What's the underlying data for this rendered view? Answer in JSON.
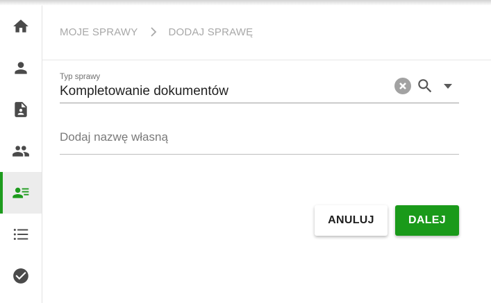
{
  "sidebar": {
    "items": [
      {
        "icon": "home-icon",
        "active": false
      },
      {
        "icon": "person-icon",
        "active": false
      },
      {
        "icon": "document-person-icon",
        "active": false
      },
      {
        "icon": "people-icon",
        "active": false
      },
      {
        "icon": "contact-list-icon",
        "active": true
      },
      {
        "icon": "list-icon",
        "active": false
      },
      {
        "icon": "check-circle-icon",
        "active": false
      }
    ],
    "accent_color": "#1d9b1d"
  },
  "breadcrumb": {
    "items": [
      "MOJE SPRAWY",
      "DODAJ SPRAWĘ"
    ]
  },
  "form": {
    "case_type": {
      "label": "Typ sprawy",
      "value": "Kompletowanie dokumentów"
    },
    "custom_name": {
      "placeholder": "Dodaj nazwę własną",
      "value": ""
    }
  },
  "actions": {
    "cancel_label": "ANULUJ",
    "next_label": "DALEJ",
    "next_color": "#1a9a1a"
  }
}
